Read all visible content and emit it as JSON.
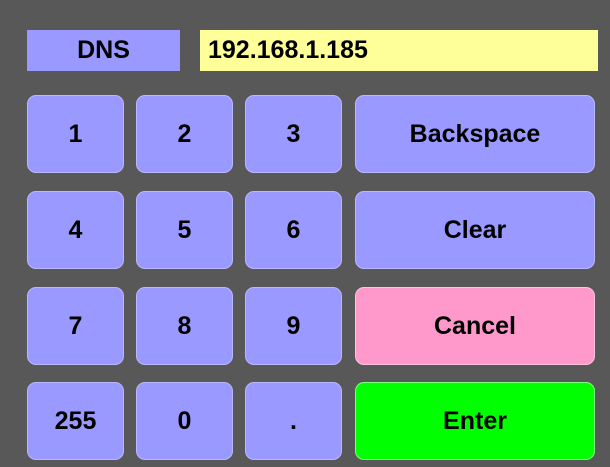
{
  "field": {
    "label": "DNS",
    "value": "192.168.1.185"
  },
  "keys": {
    "k1": "1",
    "k2": "2",
    "k3": "3",
    "k4": "4",
    "k5": "5",
    "k6": "6",
    "k7": "7",
    "k8": "8",
    "k9": "9",
    "k255": "255",
    "k0": "0",
    "dot": "."
  },
  "actions": {
    "backspace": "Backspace",
    "clear": "Clear",
    "cancel": "Cancel",
    "enter": "Enter"
  },
  "colors": {
    "background": "#585858",
    "key": "#9999ff",
    "value_field": "#ffff99",
    "cancel": "#ff99cc",
    "enter": "#00ff00"
  }
}
